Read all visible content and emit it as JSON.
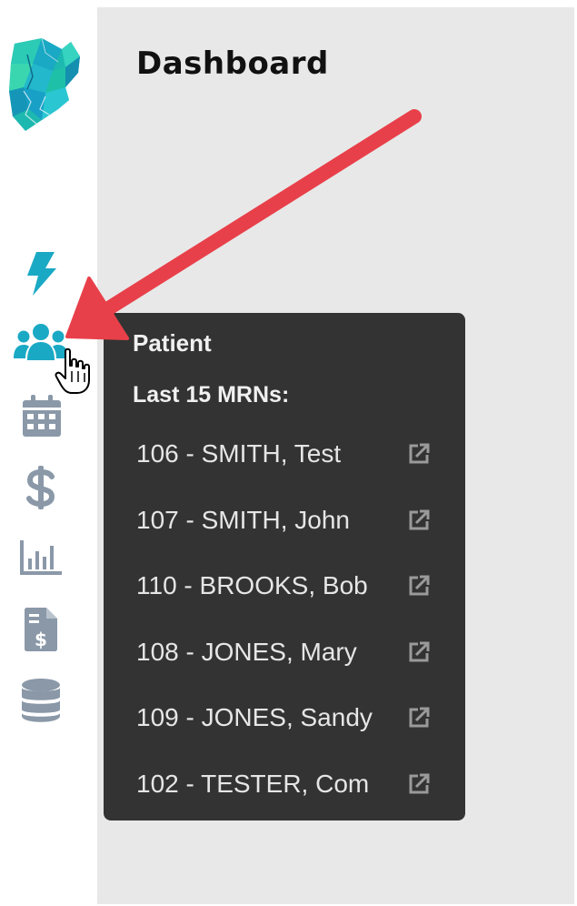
{
  "header": {
    "title": "Dashboard"
  },
  "sidebar": {
    "items": [
      {
        "icon": "lightning-bolt-icon",
        "color": "#1aa9c4"
      },
      {
        "icon": "users-icon",
        "color": "#1aa9c4"
      },
      {
        "icon": "calendar-icon",
        "color": "#8a98a8"
      },
      {
        "icon": "dollar-icon",
        "color": "#8a98a8"
      },
      {
        "icon": "bar-chart-icon",
        "color": "#8a98a8"
      },
      {
        "icon": "invoice-icon",
        "color": "#8a98a8"
      },
      {
        "icon": "database-icon",
        "color": "#8a98a8"
      }
    ]
  },
  "popover": {
    "title": "Patient",
    "subtitle": "Last 15 MRNs:",
    "items": [
      {
        "label": "106 - SMITH, Test"
      },
      {
        "label": "107 - SMITH, John"
      },
      {
        "label": "110 - BROOKS, Bob"
      },
      {
        "label": "108 - JONES, Mary"
      },
      {
        "label": "109 - JONES, Sandy"
      },
      {
        "label": "102 - TESTER, Com"
      }
    ]
  },
  "colors": {
    "accent": "#1aa9c4",
    "icon_muted": "#8a98a8",
    "popover_bg": "#333333",
    "annotation_arrow": "#e8404a",
    "main_bg": "#e8e8e8"
  }
}
